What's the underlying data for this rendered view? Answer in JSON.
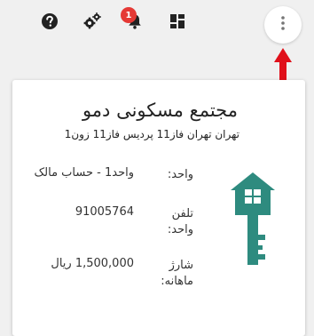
{
  "toolbar": {
    "help_icon": "help-circle-icon",
    "settings_icon": "gear-icon",
    "notifications_icon": "bell-icon",
    "notifications_badge": "1",
    "dashboard_icon": "dashboard-icon",
    "more_icon": "more-vert-icon"
  },
  "annotation": {
    "arrow_color": "#e0101a"
  },
  "card": {
    "title": "مجتمع مسکونی دمو",
    "subtitle": "تهران تهران فاز11 پردیس فاز11 زون1",
    "rows": [
      {
        "label": "واحد:",
        "value": "واحد1 - حساب مالک"
      },
      {
        "label": "تلفن واحد:",
        "value": "91005764"
      },
      {
        "label": "شارژ ماهانه:",
        "value": "1,500,000 ریال"
      }
    ],
    "key_icon": "house-key-icon",
    "key_color": "#2e8b7f"
  }
}
